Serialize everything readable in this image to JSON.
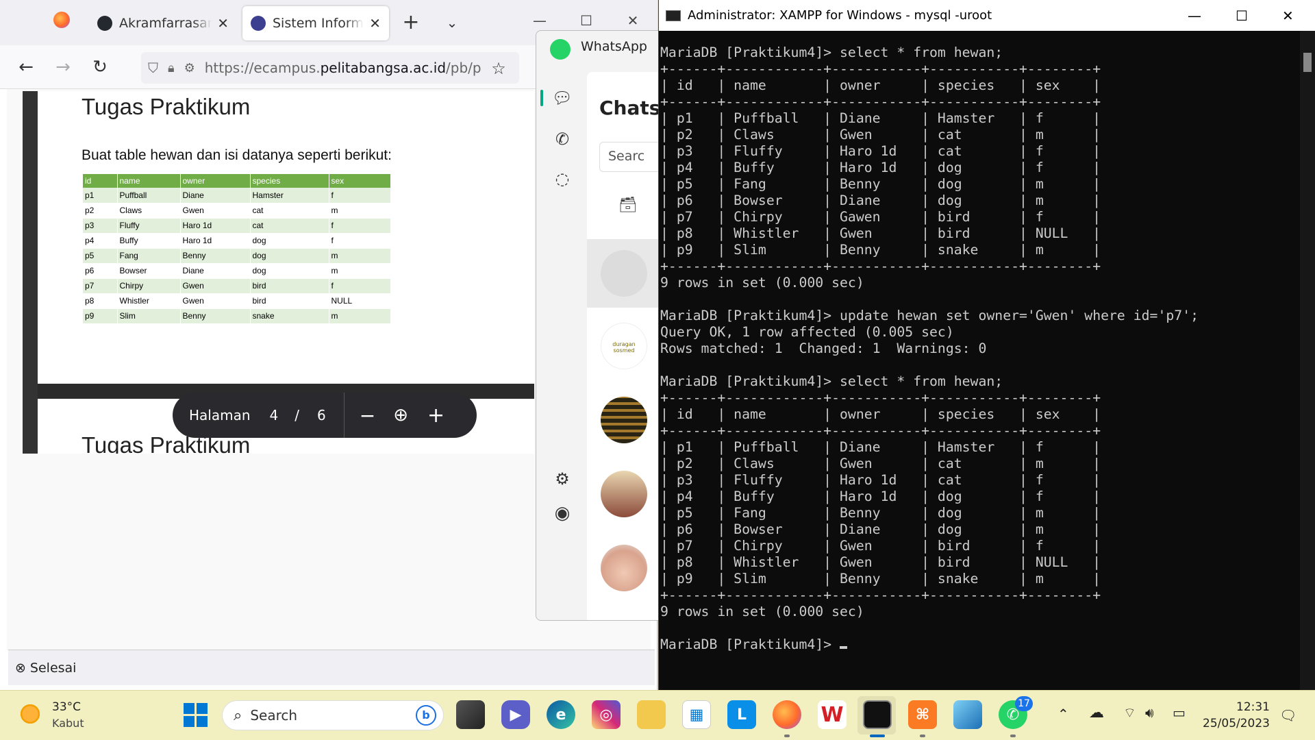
{
  "firefox": {
    "tabs": [
      {
        "label": "Akramfarrasanto"
      },
      {
        "label": "Sistem Informasi"
      }
    ],
    "new_tab": "+",
    "url_prefix": "https://ecampus.",
    "url_host": "pelitabangsa.ac.id",
    "url_path": "/pb/p",
    "status": "Selesai",
    "pdf": {
      "title": "Tugas Praktikum",
      "description": "Buat table hewan dan isi datanya seperti berikut:",
      "table_headers": [
        "id",
        "name",
        "owner",
        "species",
        "sex"
      ],
      "table_rows": [
        [
          "p1",
          "Puffball",
          "Diane",
          "Hamster",
          "f"
        ],
        [
          "p2",
          "Claws",
          "Gwen",
          "cat",
          "m"
        ],
        [
          "p3",
          "Fluffy",
          "Haro 1d",
          "cat",
          "f"
        ],
        [
          "p4",
          "Buffy",
          "Haro 1d",
          "dog",
          "f"
        ],
        [
          "p5",
          "Fang",
          "Benny",
          "dog",
          "m"
        ],
        [
          "p6",
          "Bowser",
          "Diane",
          "dog",
          "m"
        ],
        [
          "p7",
          "Chirpy",
          "Gwen",
          "bird",
          "f"
        ],
        [
          "p8",
          "Whistler",
          "Gwen",
          "bird",
          "NULL"
        ],
        [
          "p9",
          "Slim",
          "Benny",
          "snake",
          "m"
        ]
      ],
      "next_page_title": "Tugas Praktikum",
      "pager": {
        "label": "Halaman",
        "current": "4",
        "sep": "/",
        "total": "6"
      }
    }
  },
  "whatsapp": {
    "title": "WhatsApp",
    "chats_heading": "Chats",
    "search_placeholder": "Searc",
    "avatar_caption_duragan": "duragan sosmed"
  },
  "terminal": {
    "title": "Administrator:  XAMPP for Windows - mysql  -uroot",
    "prompt": "MariaDB [Praktikum4]> ",
    "commands": [
      "select * from hewan;",
      "update hewan set owner='Gwen' where id='p7';",
      "select * from hewan;"
    ],
    "columns": [
      "id",
      "name",
      "owner",
      "species",
      "sex"
    ],
    "result1": [
      [
        "p1",
        "Puffball",
        "Diane",
        "Hamster",
        "f"
      ],
      [
        "p2",
        "Claws",
        "Gwen",
        "cat",
        "m"
      ],
      [
        "p3",
        "Fluffy",
        "Haro 1d",
        "cat",
        "f"
      ],
      [
        "p4",
        "Buffy",
        "Haro 1d",
        "dog",
        "f"
      ],
      [
        "p5",
        "Fang",
        "Benny",
        "dog",
        "m"
      ],
      [
        "p6",
        "Bowser",
        "Diane",
        "dog",
        "m"
      ],
      [
        "p7",
        "Chirpy",
        "Gawen",
        "bird",
        "f"
      ],
      [
        "p8",
        "Whistler",
        "Gwen",
        "bird",
        "NULL"
      ],
      [
        "p9",
        "Slim",
        "Benny",
        "snake",
        "m"
      ]
    ],
    "result2": [
      [
        "p1",
        "Puffball",
        "Diane",
        "Hamster",
        "f"
      ],
      [
        "p2",
        "Claws",
        "Gwen",
        "cat",
        "m"
      ],
      [
        "p3",
        "Fluffy",
        "Haro 1d",
        "cat",
        "f"
      ],
      [
        "p4",
        "Buffy",
        "Haro 1d",
        "dog",
        "f"
      ],
      [
        "p5",
        "Fang",
        "Benny",
        "dog",
        "m"
      ],
      [
        "p6",
        "Bowser",
        "Diane",
        "dog",
        "m"
      ],
      [
        "p7",
        "Chirpy",
        "Gwen",
        "bird",
        "f"
      ],
      [
        "p8",
        "Whistler",
        "Gwen",
        "bird",
        "NULL"
      ],
      [
        "p9",
        "Slim",
        "Benny",
        "snake",
        "m"
      ]
    ],
    "rows_in_set": "9 rows in set (0.000 sec)",
    "update_ok": "Query OK, 1 row affected (0.005 sec)",
    "update_info": "Rows matched: 1  Changed: 1  Warnings: 0"
  },
  "taskbar": {
    "weather_temp": "33°C",
    "weather_desc": "Kabut",
    "search_label": "Search",
    "whatsapp_badge": "17",
    "time": "12:31",
    "date": "25/05/2023"
  },
  "colors": {
    "terminal_bg": "#0c0c0c",
    "terminal_fg": "#cccccc",
    "table_header_green": "#70ad47",
    "taskbar_bg": "#f2f0c0",
    "whatsapp_green": "#25d366"
  }
}
